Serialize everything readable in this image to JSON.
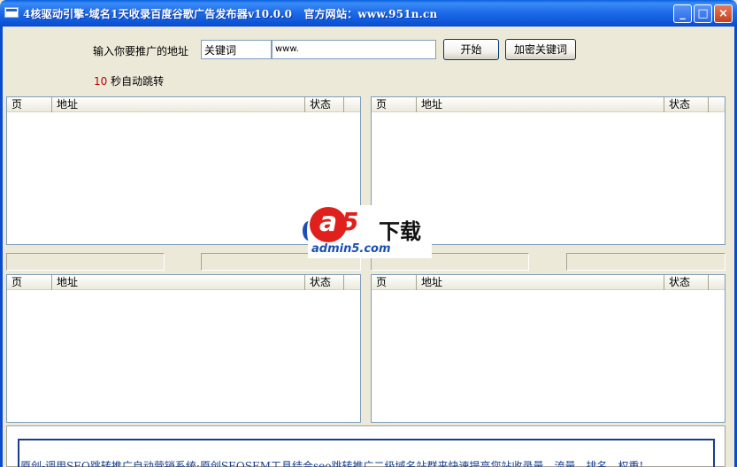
{
  "window": {
    "title": "4核驱动引擎-域名1天收录百度谷歌广告发布器v10.0.0   官方网站：www.951n.cn",
    "minimize_glyph": "_",
    "maximize_glyph": "□",
    "close_glyph": "×"
  },
  "form": {
    "address_label": "输入你要推广的地址",
    "keyword_value": "关键词",
    "url_value": "www.",
    "start_button": "开始",
    "encrypt_button": "加密关键词",
    "countdown_number": "10",
    "countdown_text": "秒自动跳转"
  },
  "lists": {
    "columns": [
      "页",
      "地址",
      "状态"
    ]
  },
  "info": {
    "text": "原创-调用SEO跳转推广自动营销系统;原创SEOSEM工具结合seo跳转推广二级域名站群来快速提高您站收录量、流量、排名、权重!"
  },
  "watermark": {
    "logo_letter": "a",
    "logo_digit": "5",
    "logo_text": "下载",
    "url": "admin5.com"
  }
}
